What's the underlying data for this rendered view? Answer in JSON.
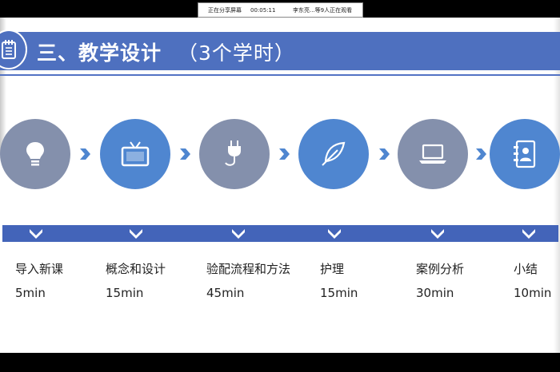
{
  "share_bar": {
    "status": "正在分享屏幕",
    "elapsed": "00:05:11",
    "viewers": "李东亮...等9人正在观看"
  },
  "header": {
    "title": "三、教学设计",
    "subtitle": "（3个学时）",
    "icon": "notepad-icon"
  },
  "steps": [
    {
      "label": "导入新课",
      "duration": "5min",
      "icon": "lightbulb-icon",
      "color": "#8490ac"
    },
    {
      "label": "概念和设计",
      "duration": "15min",
      "icon": "tv-icon",
      "color": "#4f86d0"
    },
    {
      "label": "验配流程和方法",
      "duration": "45min",
      "icon": "plug-icon",
      "color": "#8490ac"
    },
    {
      "label": "护理",
      "duration": "15min",
      "icon": "feather-icon",
      "color": "#4f86d0"
    },
    {
      "label": "案例分析",
      "duration": "30min",
      "icon": "laptop-icon",
      "color": "#8490ac"
    },
    {
      "label": "小结",
      "duration": "10min",
      "icon": "address-book-icon",
      "color": "#4f86d0"
    }
  ],
  "colors": {
    "header": "#4e70bf",
    "band": "#4364b9",
    "arrow": "#4f86d0"
  }
}
